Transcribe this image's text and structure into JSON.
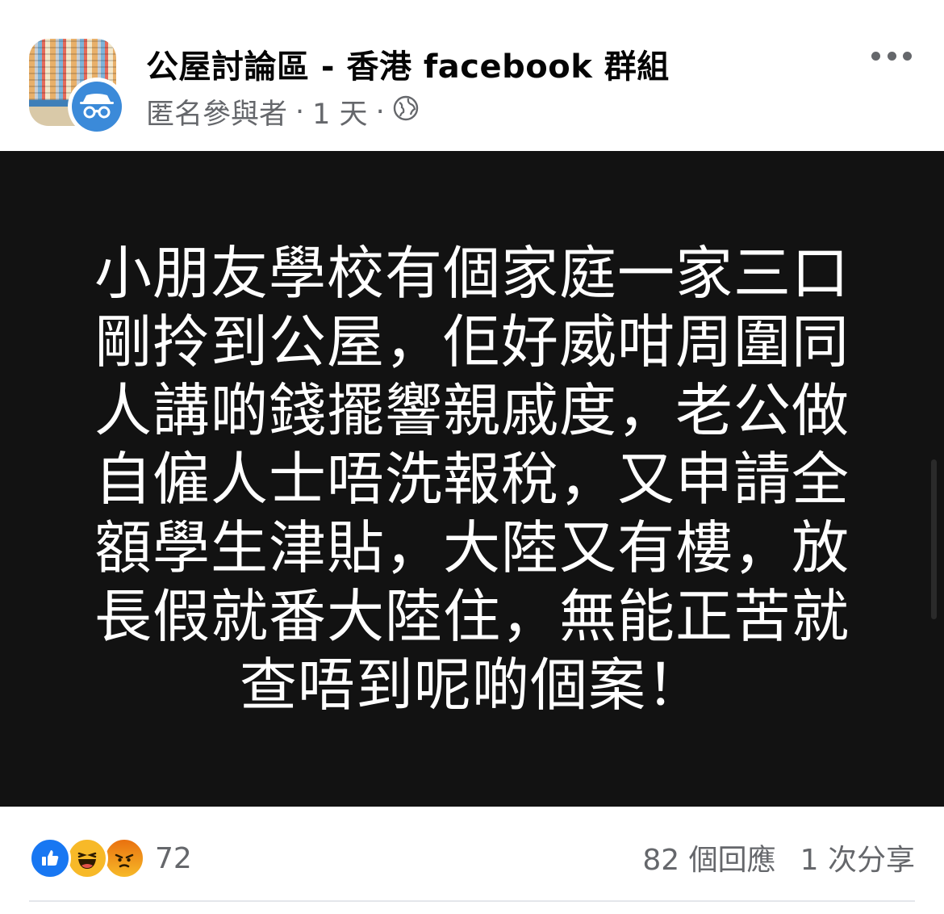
{
  "header": {
    "group_title": "公屋討論區 - 香港 facebook 群組",
    "author": "匿名參與者",
    "separator": "·",
    "time": "1 天",
    "privacy_icon": "globe-icon",
    "avatar_icon": "anonymous-incognito-icon",
    "more_icon": "more-dots-icon"
  },
  "post": {
    "lines": [
      "小朋友學校有個家庭一家三口",
      "剛拎到公屋，佢好威咁周圍同",
      "人講啲錢擺響親戚度，老公做",
      "自僱人士唔洗報稅，又申請全",
      "額學生津貼，大陸又有樓，放",
      "長假就番大陸住，無能正苦就",
      "查唔到呢啲個案！"
    ],
    "background_color": "#121212",
    "text_color": "#ffffff"
  },
  "footer": {
    "reaction_icons": [
      "like-icon",
      "haha-icon",
      "angry-icon"
    ],
    "reaction_count": "72",
    "comments": "82 個回應",
    "shares": "1 次分享"
  }
}
